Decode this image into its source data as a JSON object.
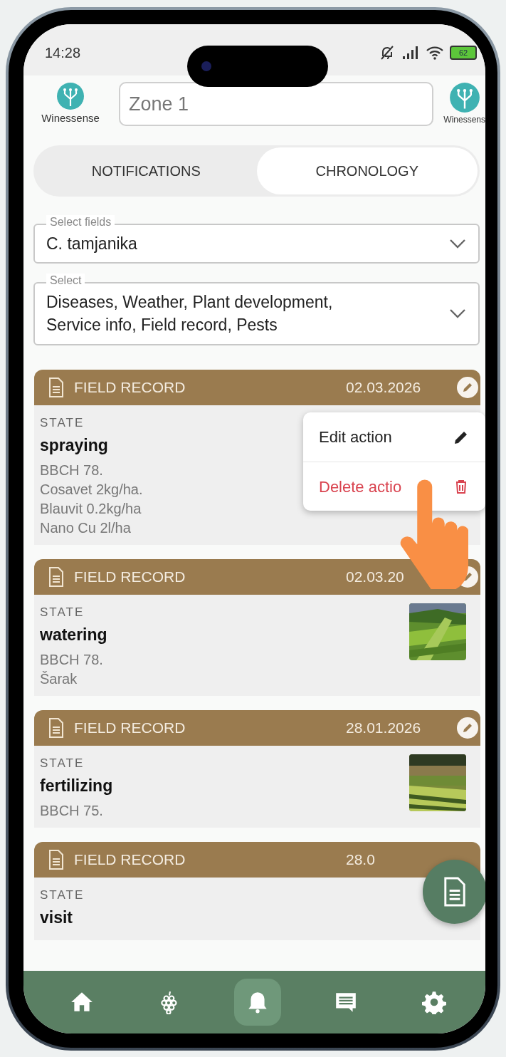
{
  "status_bar": {
    "time": "14:28",
    "battery": "62"
  },
  "header": {
    "logo_left": "Winessense",
    "zone_field": {
      "placeholder": "Zone 1"
    },
    "logo_right": "Winessens"
  },
  "tabs": [
    {
      "label": "NOTIFICATIONS",
      "selected": false
    },
    {
      "label": "CHRONOLOGY",
      "selected": true
    }
  ],
  "filters": [
    {
      "label": "Select fields",
      "value": "C. tamjanika"
    },
    {
      "label": "Select",
      "value": "Diseases, Weather, Plant development, Service info, Field record, Pests"
    }
  ],
  "records": [
    {
      "type": "FIELD RECORD",
      "date": "02.03.2026",
      "edit_icon": true,
      "state_label": "STATE",
      "state": "spraying",
      "details": [
        "BBCH 78.",
        "Cosavet 2kg/ha.",
        "Blauvit 0.2kg/ha",
        "Nano Cu 2l/ha"
      ],
      "photo": false
    },
    {
      "type": "FIELD RECORD",
      "date": "02.03.20",
      "edit_icon": true,
      "state_label": "STATE",
      "state": "watering",
      "details": [
        "BBCH 78.",
        "Šarak"
      ],
      "photo": true
    },
    {
      "type": "FIELD RECORD",
      "date": "28.01.2026",
      "edit_icon": true,
      "state_label": "STATE",
      "state": "fertilizing",
      "details": [
        "BBCH 75."
      ],
      "photo": true
    },
    {
      "type": "FIELD RECORD",
      "date": "28.0",
      "edit_icon": false,
      "state_label": "STATE",
      "state": "visit",
      "photo": false
    }
  ],
  "context_menu": {
    "items": [
      {
        "label": "Edit action",
        "kind": "edit"
      },
      {
        "label": "Delete actio",
        "kind": "delete"
      }
    ]
  },
  "bottom_nav": [
    {
      "kind": "home",
      "selected": false
    },
    {
      "kind": "grapes",
      "selected": false
    },
    {
      "kind": "bell",
      "selected": true
    },
    {
      "kind": "message",
      "selected": false
    },
    {
      "kind": "settings",
      "selected": false
    }
  ]
}
